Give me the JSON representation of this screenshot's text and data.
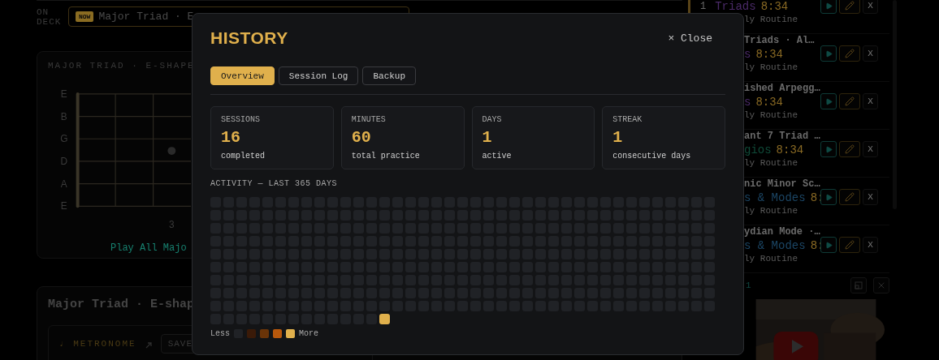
{
  "background": {
    "on_deck": {
      "label": "ON DECK",
      "badge": "NOW",
      "title": "Major Triad · E"
    },
    "diagram_card": {
      "title": "MAJOR TRIAD · E-SHAPE",
      "strings": [
        "E",
        "B",
        "G",
        "D",
        "A",
        "E"
      ],
      "fret_number": "3",
      "play_button": "Play All Majo"
    },
    "exercise_card": {
      "title": "Major Triad · E-shap",
      "metronome": "♩ METRONOME",
      "save_button": "SAVE"
    },
    "queue": [
      {
        "current": true,
        "number": "1",
        "category": "Triads",
        "color": "#4a2a68",
        "time": "8:34",
        "routine": "ly Routine",
        "remove": "X"
      },
      {
        "current": false,
        "title": "Triads · Al…",
        "category": "s",
        "color": "#4a2a68",
        "time": "8:34",
        "routine": "ly Routine",
        "remove": "X"
      },
      {
        "current": false,
        "title": "ished Arpegg…",
        "category": "s",
        "color": "#4a2a68",
        "time": "8:34",
        "routine": "ly Routine",
        "remove": "X"
      },
      {
        "current": false,
        "title": "ant 7 Triad …",
        "category": "gios",
        "color": "#0f4a38",
        "time": "8:34",
        "routine": "ly Routine",
        "remove": "X"
      },
      {
        "current": false,
        "title": "nic Minor Sc…",
        "category": "s & Modes",
        "color": "#1b4564",
        "time": "8:",
        "routine": "ly Routine",
        "remove": "X"
      },
      {
        "current": false,
        "title": "ydian Mode ·…",
        "category": "s & Modes",
        "color": "#1b4564",
        "time": "8:",
        "routine": "ly Routine",
        "remove": "X"
      }
    ],
    "video": {
      "label": "1"
    }
  },
  "history": {
    "title": "HISTORY",
    "close": "× Close",
    "tabs": [
      {
        "label": "Overview",
        "selected": true
      },
      {
        "label": "Session Log",
        "selected": false
      },
      {
        "label": "Backup",
        "selected": false
      }
    ],
    "stats": [
      {
        "label": "SESSIONS",
        "value": "16",
        "caption": "completed"
      },
      {
        "label": "MINUTES",
        "value": "60",
        "caption": "total practice"
      },
      {
        "label": "DAYS",
        "value": "1",
        "caption": "active"
      },
      {
        "label": "STREAK",
        "value": "1",
        "caption": "consecutive days"
      }
    ],
    "activity": {
      "title": "ACTIVITY — LAST 365 DAYS",
      "days": [
        {
          "color": "#202226"
        },
        {
          "color": "#202226"
        },
        {
          "color": "#202226"
        },
        {
          "color": "#202226"
        },
        {
          "color": "#202226"
        },
        {
          "color": "#202226"
        },
        {
          "color": "#202226"
        },
        {
          "color": "#202226"
        },
        {
          "color": "#202226"
        },
        {
          "color": "#202226"
        },
        {
          "color": "#202226"
        },
        {
          "color": "#202226"
        },
        {
          "color": "#202226"
        },
        {
          "color": "#202226"
        },
        {
          "color": "#202226"
        },
        {
          "color": "#202226"
        },
        {
          "color": "#202226"
        },
        {
          "color": "#202226"
        },
        {
          "color": "#202226"
        },
        {
          "color": "#202226"
        },
        {
          "color": "#202226"
        },
        {
          "color": "#202226"
        },
        {
          "color": "#202226"
        },
        {
          "color": "#202226"
        },
        {
          "color": "#202226"
        },
        {
          "color": "#202226"
        },
        {
          "color": "#202226"
        },
        {
          "color": "#202226"
        },
        {
          "color": "#202226"
        },
        {
          "color": "#202226"
        },
        {
          "color": "#202226"
        },
        {
          "color": "#202226"
        },
        {
          "color": "#202226"
        },
        {
          "color": "#202226"
        },
        {
          "color": "#202226"
        },
        {
          "color": "#202226"
        },
        {
          "color": "#202226"
        },
        {
          "color": "#202226"
        },
        {
          "color": "#202226"
        },
        {
          "color": "#202226"
        },
        {
          "color": "#202226"
        },
        {
          "color": "#202226"
        },
        {
          "color": "#202226"
        },
        {
          "color": "#202226"
        },
        {
          "color": "#202226"
        },
        {
          "color": "#202226"
        },
        {
          "color": "#202226"
        },
        {
          "color": "#202226"
        },
        {
          "color": "#202226"
        },
        {
          "color": "#202226"
        },
        {
          "color": "#202226"
        },
        {
          "color": "#202226"
        },
        {
          "color": "#202226"
        },
        {
          "color": "#202226"
        },
        {
          "color": "#202226"
        },
        {
          "color": "#202226"
        },
        {
          "color": "#202226"
        },
        {
          "color": "#202226"
        },
        {
          "color": "#202226"
        },
        {
          "color": "#202226"
        },
        {
          "color": "#202226"
        },
        {
          "color": "#202226"
        },
        {
          "color": "#202226"
        },
        {
          "color": "#202226"
        },
        {
          "color": "#202226"
        },
        {
          "color": "#202226"
        },
        {
          "color": "#202226"
        },
        {
          "color": "#202226"
        },
        {
          "color": "#202226"
        },
        {
          "color": "#202226"
        },
        {
          "color": "#202226"
        },
        {
          "color": "#202226"
        },
        {
          "color": "#202226"
        },
        {
          "color": "#202226"
        },
        {
          "color": "#202226"
        },
        {
          "color": "#202226"
        },
        {
          "color": "#202226"
        },
        {
          "color": "#202226"
        },
        {
          "color": "#202226"
        },
        {
          "color": "#202226"
        },
        {
          "color": "#202226"
        },
        {
          "color": "#202226"
        },
        {
          "color": "#202226"
        },
        {
          "color": "#202226"
        },
        {
          "color": "#202226"
        },
        {
          "color": "#202226"
        },
        {
          "color": "#202226"
        },
        {
          "color": "#202226"
        },
        {
          "color": "#202226"
        },
        {
          "color": "#202226"
        },
        {
          "color": "#202226"
        },
        {
          "color": "#202226"
        },
        {
          "color": "#202226"
        },
        {
          "color": "#202226"
        },
        {
          "color": "#202226"
        },
        {
          "color": "#202226"
        },
        {
          "color": "#202226"
        },
        {
          "color": "#202226"
        },
        {
          "color": "#202226"
        },
        {
          "color": "#202226"
        },
        {
          "color": "#202226"
        },
        {
          "color": "#202226"
        },
        {
          "color": "#202226"
        },
        {
          "color": "#202226"
        },
        {
          "color": "#202226"
        },
        {
          "color": "#202226"
        },
        {
          "color": "#202226"
        },
        {
          "color": "#202226"
        },
        {
          "color": "#202226"
        },
        {
          "color": "#202226"
        },
        {
          "color": "#202226"
        },
        {
          "color": "#202226"
        },
        {
          "color": "#202226"
        },
        {
          "color": "#202226"
        },
        {
          "color": "#202226"
        },
        {
          "color": "#202226"
        },
        {
          "color": "#202226"
        },
        {
          "color": "#202226"
        },
        {
          "color": "#202226"
        },
        {
          "color": "#202226"
        },
        {
          "color": "#202226"
        },
        {
          "color": "#202226"
        },
        {
          "color": "#202226"
        },
        {
          "color": "#202226"
        },
        {
          "color": "#202226"
        },
        {
          "color": "#202226"
        },
        {
          "color": "#202226"
        },
        {
          "color": "#202226"
        },
        {
          "color": "#202226"
        },
        {
          "color": "#202226"
        },
        {
          "color": "#202226"
        },
        {
          "color": "#202226"
        },
        {
          "color": "#202226"
        },
        {
          "color": "#202226"
        },
        {
          "color": "#202226"
        },
        {
          "color": "#202226"
        },
        {
          "color": "#202226"
        },
        {
          "color": "#202226"
        },
        {
          "color": "#202226"
        },
        {
          "color": "#202226"
        },
        {
          "color": "#202226"
        },
        {
          "color": "#202226"
        },
        {
          "color": "#202226"
        },
        {
          "color": "#202226"
        },
        {
          "color": "#202226"
        },
        {
          "color": "#202226"
        },
        {
          "color": "#202226"
        },
        {
          "color": "#202226"
        },
        {
          "color": "#202226"
        },
        {
          "color": "#202226"
        },
        {
          "color": "#202226"
        },
        {
          "color": "#202226"
        },
        {
          "color": "#202226"
        },
        {
          "color": "#202226"
        },
        {
          "color": "#202226"
        },
        {
          "color": "#202226"
        },
        {
          "color": "#202226"
        },
        {
          "color": "#202226"
        },
        {
          "color": "#202226"
        },
        {
          "color": "#202226"
        },
        {
          "color": "#202226"
        },
        {
          "color": "#202226"
        },
        {
          "color": "#202226"
        },
        {
          "color": "#202226"
        },
        {
          "color": "#202226"
        },
        {
          "color": "#202226"
        },
        {
          "color": "#202226"
        },
        {
          "color": "#202226"
        },
        {
          "color": "#202226"
        },
        {
          "color": "#202226"
        },
        {
          "color": "#202226"
        },
        {
          "color": "#202226"
        },
        {
          "color": "#202226"
        },
        {
          "color": "#202226"
        },
        {
          "color": "#202226"
        },
        {
          "color": "#202226"
        },
        {
          "color": "#202226"
        },
        {
          "color": "#202226"
        },
        {
          "color": "#202226"
        },
        {
          "color": "#202226"
        },
        {
          "color": "#202226"
        },
        {
          "color": "#202226"
        },
        {
          "color": "#202226"
        },
        {
          "color": "#202226"
        },
        {
          "color": "#202226"
        },
        {
          "color": "#202226"
        },
        {
          "color": "#202226"
        },
        {
          "color": "#202226"
        },
        {
          "color": "#202226"
        },
        {
          "color": "#202226"
        },
        {
          "color": "#202226"
        },
        {
          "color": "#202226"
        },
        {
          "color": "#202226"
        },
        {
          "color": "#202226"
        },
        {
          "color": "#202226"
        },
        {
          "color": "#202226"
        },
        {
          "color": "#202226"
        },
        {
          "color": "#202226"
        },
        {
          "color": "#202226"
        },
        {
          "color": "#202226"
        },
        {
          "color": "#202226"
        },
        {
          "color": "#202226"
        },
        {
          "color": "#202226"
        },
        {
          "color": "#202226"
        },
        {
          "color": "#202226"
        },
        {
          "color": "#202226"
        },
        {
          "color": "#202226"
        },
        {
          "color": "#202226"
        },
        {
          "color": "#202226"
        },
        {
          "color": "#202226"
        },
        {
          "color": "#202226"
        },
        {
          "color": "#202226"
        },
        {
          "color": "#202226"
        },
        {
          "color": "#202226"
        },
        {
          "color": "#202226"
        },
        {
          "color": "#202226"
        },
        {
          "color": "#202226"
        },
        {
          "color": "#202226"
        },
        {
          "color": "#202226"
        },
        {
          "color": "#202226"
        },
        {
          "color": "#202226"
        },
        {
          "color": "#202226"
        },
        {
          "color": "#202226"
        },
        {
          "color": "#202226"
        },
        {
          "color": "#202226"
        },
        {
          "color": "#202226"
        },
        {
          "color": "#202226"
        },
        {
          "color": "#202226"
        },
        {
          "color": "#202226"
        },
        {
          "color": "#202226"
        },
        {
          "color": "#202226"
        },
        {
          "color": "#202226"
        },
        {
          "color": "#202226"
        },
        {
          "color": "#202226"
        },
        {
          "color": "#202226"
        },
        {
          "color": "#202226"
        },
        {
          "color": "#202226"
        },
        {
          "color": "#202226"
        },
        {
          "color": "#202226"
        },
        {
          "color": "#202226"
        },
        {
          "color": "#202226"
        },
        {
          "color": "#202226"
        },
        {
          "color": "#202226"
        },
        {
          "color": "#202226"
        },
        {
          "color": "#202226"
        },
        {
          "color": "#202226"
        },
        {
          "color": "#202226"
        },
        {
          "color": "#202226"
        },
        {
          "color": "#202226"
        },
        {
          "color": "#202226"
        },
        {
          "color": "#202226"
        },
        {
          "color": "#202226"
        },
        {
          "color": "#202226"
        },
        {
          "color": "#202226"
        },
        {
          "color": "#202226"
        },
        {
          "color": "#202226"
        },
        {
          "color": "#202226"
        },
        {
          "color": "#202226"
        },
        {
          "color": "#202226"
        },
        {
          "color": "#202226"
        },
        {
          "color": "#202226"
        },
        {
          "color": "#202226"
        },
        {
          "color": "#202226"
        },
        {
          "color": "#202226"
        },
        {
          "color": "#202226"
        },
        {
          "color": "#202226"
        },
        {
          "color": "#202226"
        },
        {
          "color": "#202226"
        },
        {
          "color": "#202226"
        },
        {
          "color": "#202226"
        },
        {
          "color": "#202226"
        },
        {
          "color": "#202226"
        },
        {
          "color": "#202226"
        },
        {
          "color": "#202226"
        },
        {
          "color": "#202226"
        },
        {
          "color": "#202226"
        },
        {
          "color": "#202226"
        },
        {
          "color": "#202226"
        },
        {
          "color": "#202226"
        },
        {
          "color": "#202226"
        },
        {
          "color": "#202226"
        },
        {
          "color": "#202226"
        },
        {
          "color": "#202226"
        },
        {
          "color": "#202226"
        },
        {
          "color": "#202226"
        },
        {
          "color": "#202226"
        },
        {
          "color": "#202226"
        },
        {
          "color": "#202226"
        },
        {
          "color": "#202226"
        },
        {
          "color": "#202226"
        },
        {
          "color": "#202226"
        },
        {
          "color": "#202226"
        },
        {
          "color": "#202226"
        },
        {
          "color": "#202226"
        },
        {
          "color": "#202226"
        },
        {
          "color": "#202226"
        },
        {
          "color": "#202226"
        },
        {
          "color": "#202226"
        },
        {
          "color": "#202226"
        },
        {
          "color": "#202226"
        },
        {
          "color": "#202226"
        },
        {
          "color": "#202226"
        },
        {
          "color": "#202226"
        },
        {
          "color": "#202226"
        },
        {
          "color": "#202226"
        },
        {
          "color": "#202226"
        },
        {
          "color": "#202226"
        },
        {
          "color": "#202226"
        },
        {
          "color": "#202226"
        },
        {
          "color": "#202226"
        },
        {
          "color": "#202226"
        },
        {
          "color": "#202226"
        },
        {
          "color": "#202226"
        },
        {
          "color": "#202226"
        },
        {
          "color": "#202226"
        },
        {
          "color": "#202226"
        },
        {
          "color": "#202226"
        },
        {
          "color": "#202226"
        },
        {
          "color": "#202226"
        },
        {
          "color": "#202226"
        },
        {
          "color": "#202226"
        },
        {
          "color": "#202226"
        },
        {
          "color": "#202226"
        },
        {
          "color": "#202226"
        },
        {
          "color": "#202226"
        },
        {
          "color": "#202226"
        },
        {
          "color": "#202226"
        },
        {
          "color": "#202226"
        },
        {
          "color": "#202226"
        },
        {
          "color": "#202226"
        },
        {
          "color": "#202226"
        },
        {
          "color": "#202226"
        },
        {
          "color": "#202226"
        },
        {
          "color": "#202226"
        },
        {
          "color": "#202226"
        },
        {
          "color": "#202226"
        },
        {
          "color": "#202226"
        },
        {
          "color": "#202226"
        },
        {
          "color": "#202226"
        },
        {
          "color": "#202226"
        },
        {
          "color": "#202226"
        },
        {
          "color": "#202226"
        },
        {
          "color": "#202226"
        },
        {
          "color": "#202226"
        },
        {
          "color": "#202226"
        },
        {
          "color": "#202226"
        },
        {
          "color": "#202226"
        },
        {
          "color": "#202226"
        },
        {
          "color": "#202226"
        },
        {
          "color": "#202226"
        },
        {
          "color": "#202226"
        },
        {
          "color": "#202226"
        },
        {
          "color": "#202226"
        },
        {
          "color": "#202226"
        },
        {
          "color": "#202226"
        },
        {
          "color": "#202226"
        },
        {
          "color": "#202226"
        },
        {
          "color": "#202226"
        },
        {
          "color": "#202226"
        },
        {
          "color": "#202226"
        },
        {
          "color": "#202226"
        },
        {
          "color": "#202226"
        },
        {
          "color": "#202226"
        },
        {
          "color": "#202226"
        },
        {
          "color": "#e0b04c"
        }
      ],
      "legend": {
        "less": "Less",
        "more": "More",
        "swatches": [
          {
            "color": "#202226"
          },
          {
            "color": "#3a1a08"
          },
          {
            "color": "#6a3408"
          },
          {
            "color": "#b8580c"
          },
          {
            "color": "#e0b04c"
          }
        ]
      }
    }
  }
}
